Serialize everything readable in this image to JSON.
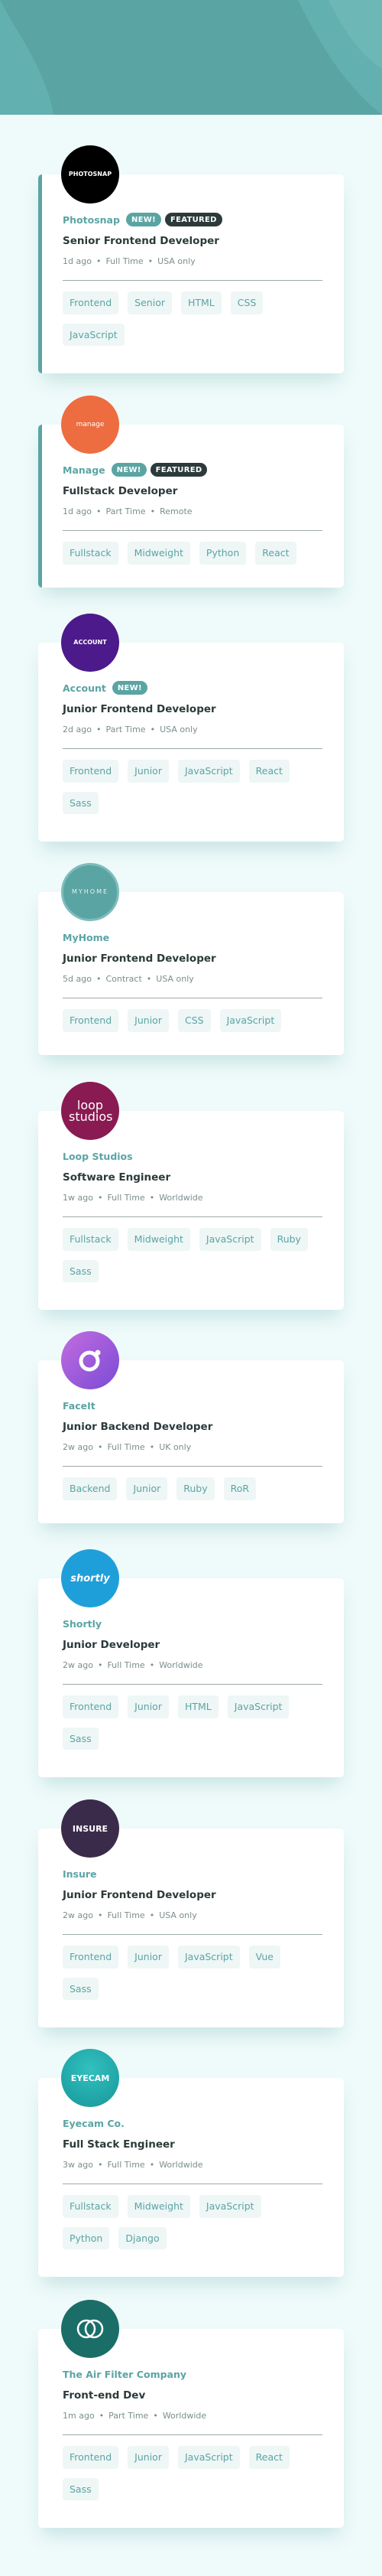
{
  "colors": {
    "accent": "#5ba4a4",
    "dark": "#2c3a3a",
    "background": "#effafa",
    "tag_bg": "#eef6f6",
    "muted": "#7b8e8e"
  },
  "header": {
    "background": "#5ba4a4"
  },
  "jobs": [
    {
      "company": "Photosnap",
      "logo_text": "PHOTOSNAP",
      "logo_bg": "#000000",
      "logo_fg": "#ffffff",
      "logo_icon": "photosnap-logo-icon",
      "new": "NEW!",
      "featured": "FEATURED",
      "position": "Senior Frontend Developer",
      "posted": "1d ago",
      "contract": "Full Time",
      "location": "USA only",
      "tags": [
        "Frontend",
        "Senior",
        "HTML",
        "CSS",
        "JavaScript"
      ]
    },
    {
      "company": "Manage",
      "logo_text": "manage",
      "logo_bg": "#ed6c40",
      "logo_fg": "#ffffff",
      "logo_icon": "manage-logo-icon",
      "new": "NEW!",
      "featured": "FEATURED",
      "position": "Fullstack Developer",
      "posted": "1d ago",
      "contract": "Part Time",
      "location": "Remote",
      "tags": [
        "Fullstack",
        "Midweight",
        "Python",
        "React"
      ]
    },
    {
      "company": "Account",
      "logo_text": "ACCOUNT",
      "logo_bg": "#4c1a8b",
      "logo_fg": "#ffffff",
      "logo_icon": "account-logo-icon",
      "new": "NEW!",
      "featured": "",
      "position": "Junior Frontend Developer",
      "posted": "2d ago",
      "contract": "Part Time",
      "location": "USA only",
      "tags": [
        "Frontend",
        "Junior",
        "JavaScript",
        "React",
        "Sass"
      ]
    },
    {
      "company": "MyHome",
      "logo_text": "MYHOME",
      "logo_bg": "#5ba4a4",
      "logo_fg": "#e6f2f2",
      "logo_icon": "myhome-logo-icon",
      "new": "",
      "featured": "",
      "position": "Junior Frontend Developer",
      "posted": "5d ago",
      "contract": "Contract",
      "location": "USA only",
      "tags": [
        "Frontend",
        "Junior",
        "CSS",
        "JavaScript"
      ]
    },
    {
      "company": "Loop Studios",
      "logo_text": "loop studios",
      "logo_bg": "#8a1a52",
      "logo_fg": "#ffffff",
      "logo_icon": "loop-studios-logo-icon",
      "new": "",
      "featured": "",
      "position": "Software Engineer",
      "posted": "1w ago",
      "contract": "Full Time",
      "location": "Worldwide",
      "tags": [
        "Fullstack",
        "Midweight",
        "JavaScript",
        "Ruby",
        "Sass"
      ]
    },
    {
      "company": "FaceIt",
      "logo_text": "",
      "logo_bg": "#a45de0",
      "logo_fg": "#ffffff",
      "logo_icon": "faceit-logo-icon",
      "new": "",
      "featured": "",
      "position": "Junior Backend Developer",
      "posted": "2w ago",
      "contract": "Full Time",
      "location": "UK only",
      "tags": [
        "Backend",
        "Junior",
        "Ruby",
        "RoR"
      ]
    },
    {
      "company": "Shortly",
      "logo_text": "shortly",
      "logo_bg": "#1f9fd9",
      "logo_fg": "#ffffff",
      "logo_icon": "shortly-logo-icon",
      "new": "",
      "featured": "",
      "position": "Junior Developer",
      "posted": "2w ago",
      "contract": "Full Time",
      "location": "Worldwide",
      "tags": [
        "Frontend",
        "Junior",
        "HTML",
        "JavaScript",
        "Sass"
      ]
    },
    {
      "company": "Insure",
      "logo_text": "INSURE",
      "logo_bg": "#3b2b4a",
      "logo_fg": "#ffffff",
      "logo_icon": "insure-logo-icon",
      "new": "",
      "featured": "",
      "position": "Junior Frontend Developer",
      "posted": "2w ago",
      "contract": "Full Time",
      "location": "USA only",
      "tags": [
        "Frontend",
        "Junior",
        "JavaScript",
        "Vue",
        "Sass"
      ]
    },
    {
      "company": "Eyecam Co.",
      "logo_text": "EYECAM",
      "logo_bg": "#1ea5a5",
      "logo_fg": "#ffffff",
      "logo_icon": "eyecam-logo-icon",
      "new": "",
      "featured": "",
      "position": "Full Stack Engineer",
      "posted": "3w ago",
      "contract": "Full Time",
      "location": "Worldwide",
      "tags": [
        "Fullstack",
        "Midweight",
        "JavaScript",
        "Python",
        "Django"
      ]
    },
    {
      "company": "The Air Filter Company",
      "logo_text": "",
      "logo_bg": "#1b6e68",
      "logo_fg": "#ffffff",
      "logo_icon": "air-filter-logo-icon",
      "new": "",
      "featured": "",
      "position": "Front-end Dev",
      "posted": "1m ago",
      "contract": "Part Time",
      "location": "Worldwide",
      "tags": [
        "Frontend",
        "Junior",
        "JavaScript",
        "React",
        "Sass"
      ]
    }
  ]
}
